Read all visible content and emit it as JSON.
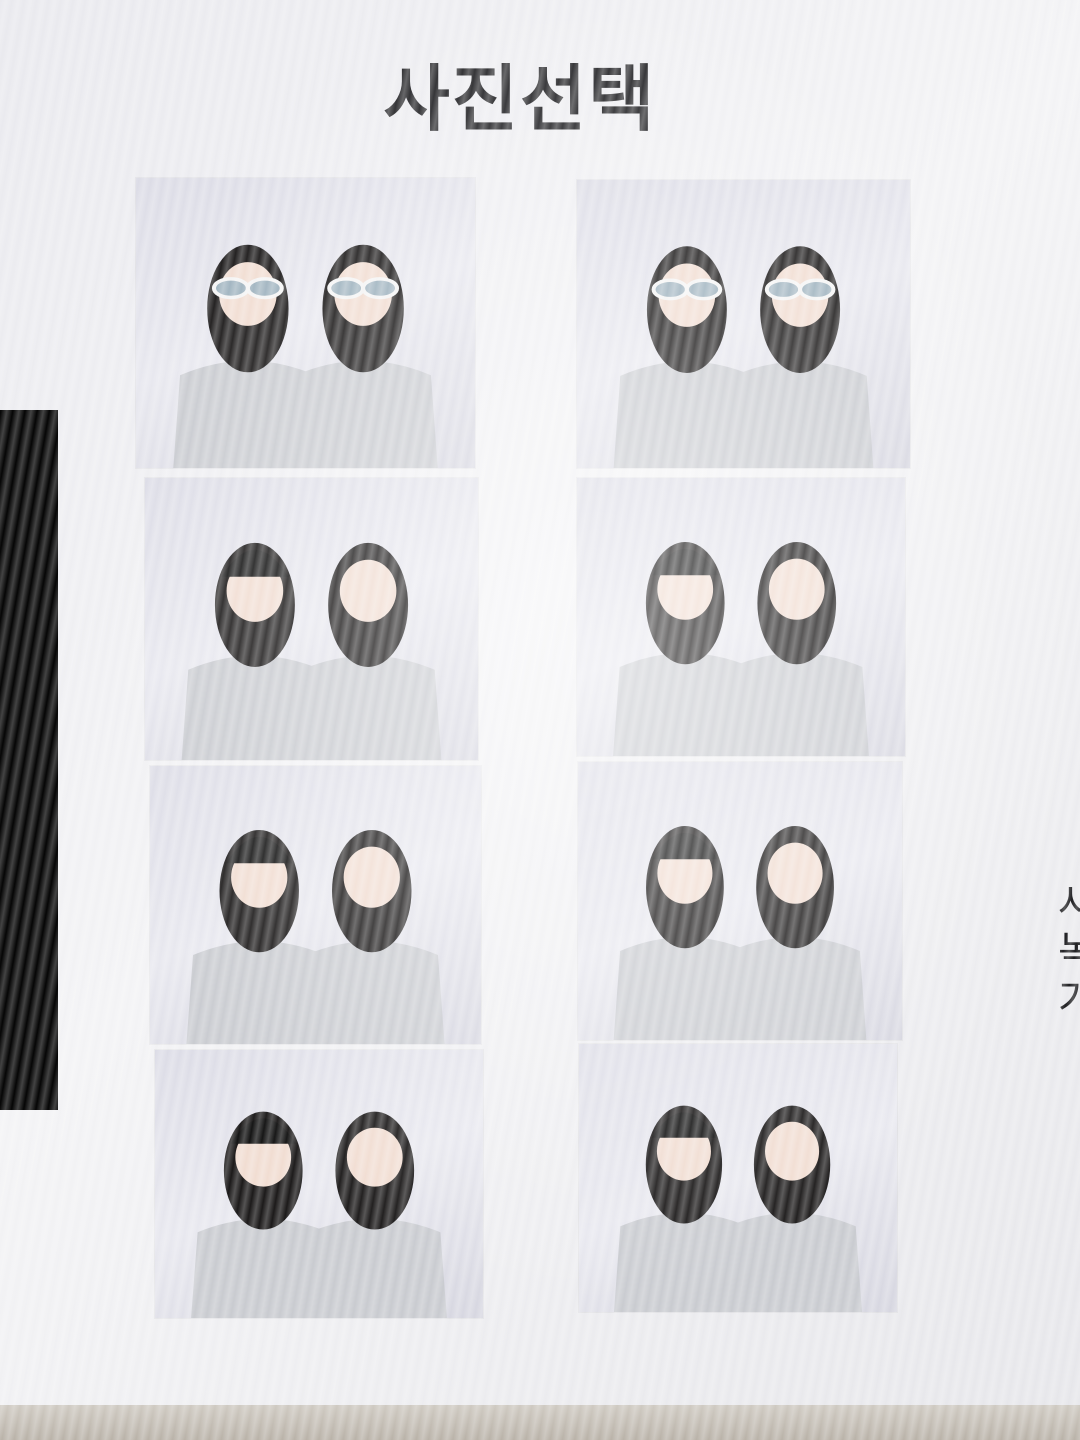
{
  "header": {
    "title": "사진선택"
  },
  "side_text": {
    "lines": [
      "사",
      "녹",
      "가"
    ]
  },
  "photos": [
    {
      "id": 1,
      "pose": "alien-glasses"
    },
    {
      "id": 2,
      "pose": "alien-glasses-peace"
    },
    {
      "id": 3,
      "pose": "peace"
    },
    {
      "id": 4,
      "pose": "cheek"
    },
    {
      "id": 5,
      "pose": "double-peace"
    },
    {
      "id": 6,
      "pose": "cheek-peace"
    },
    {
      "id": 7,
      "pose": "heart"
    },
    {
      "id": 8,
      "pose": "close-peace"
    }
  ],
  "colors": {
    "background": "#eeeef1",
    "title": "#2b2b2e",
    "sweatshirt": "#c9cbd0",
    "hair": "#1c1a1a"
  }
}
